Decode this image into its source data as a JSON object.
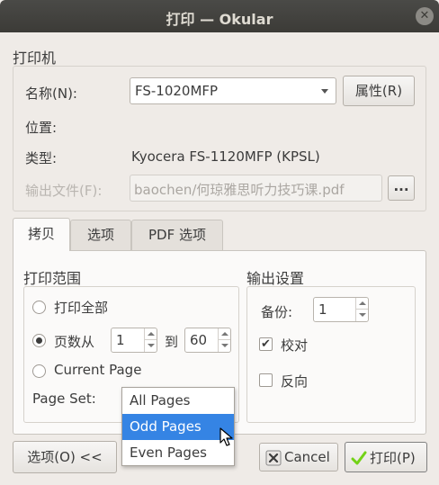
{
  "window": {
    "title": "打印 — Okular"
  },
  "printer": {
    "section_title": "打印机",
    "name_label": "名称(N):",
    "name_value": "FS-1020MFP",
    "properties_button": "属性(R)",
    "location_label": "位置:",
    "location_value": "",
    "type_label": "类型:",
    "type_value": "Kyocera FS-1120MFP (KPSL)",
    "output_file_label": "输出文件(F):",
    "output_file_value": "baochen/何琼雅思听力技巧课.pdf",
    "browse_button": "..."
  },
  "tabs": [
    {
      "label": "拷贝",
      "active": true
    },
    {
      "label": "选项",
      "active": false
    },
    {
      "label": "PDF 选项",
      "active": false
    }
  ],
  "print_range": {
    "title": "打印范围",
    "all_pages_label": "打印全部",
    "pages_from_label": "页数从",
    "from_value": "1",
    "to_label": "到",
    "to_value": "60",
    "current_page_label": "Current Page",
    "selected": "pages_from"
  },
  "page_set": {
    "label": "Page Set:",
    "options": [
      "All Pages",
      "Odd Pages",
      "Even Pages"
    ],
    "highlighted": "Odd Pages"
  },
  "output_settings": {
    "title": "输出设置",
    "copies_label": "备份:",
    "copies_value": "1",
    "collate_label": "校对",
    "collate_checked": true,
    "reverse_label": "反向",
    "reverse_checked": false
  },
  "buttons": {
    "options_toggle": "选项(O) <<",
    "cancel": "Cancel",
    "print": "打印(P)"
  },
  "colors": {
    "highlight": "#3584e4",
    "titlebar": "#3c3b37",
    "accept_icon": "#73d216",
    "cancel_icon": "#a40000"
  }
}
